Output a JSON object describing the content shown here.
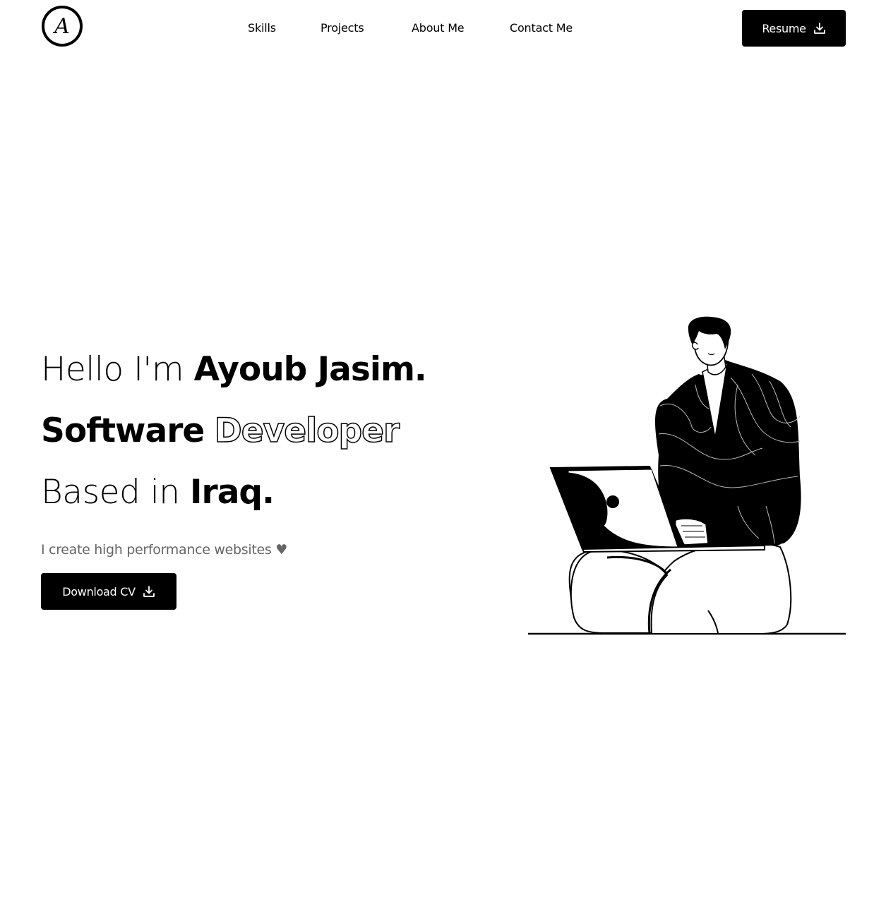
{
  "header": {
    "logo_letter": "A",
    "nav": {
      "skills": "Skills",
      "projects": "Projects",
      "about": "About Me",
      "contact": "Contact Me"
    },
    "resume_label": "Resume"
  },
  "hero": {
    "line1_prefix": "Hello I'm ",
    "line1_name": "Ayoub Jasim.",
    "line2_word1": "Software",
    "line2_word2": "Developer",
    "line3_prefix": "Based in ",
    "line3_place": "Iraq.",
    "tagline": "I create high performance websites",
    "tagline_icon": "heart-icon",
    "download_label": "Download CV"
  },
  "colors": {
    "primary": "#000000",
    "background": "#ffffff",
    "muted_text": "#666666"
  }
}
